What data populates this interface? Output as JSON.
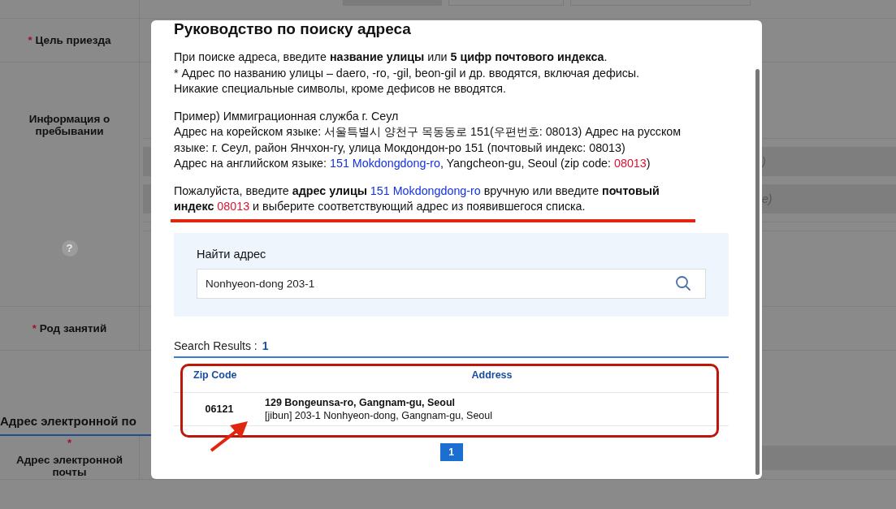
{
  "background_form": {
    "rows": [
      {
        "label": "Цель приезда",
        "mark": "*",
        "kind": "short"
      },
      {
        "label": "Информация о пребывании",
        "help": "?",
        "kind": "tall",
        "field_fragments": [
          ")",
          "e)"
        ]
      },
      {
        "label": "Род занятий",
        "mark": "*",
        "kind": "short"
      }
    ],
    "section_title": "Адрес электронной по",
    "email_row": {
      "label": "Адрес электронной почты",
      "mark": "*"
    }
  },
  "modal": {
    "title": "Руководство по поиску адреса",
    "blocks": [
      [
        [
          {
            "t": "При поиске адреса, введите ",
            "kind": "plain"
          },
          {
            "t": "название улицы",
            "kind": "bold"
          },
          {
            "t": " или ",
            "kind": "plain"
          },
          {
            "t": "5 цифр почтового индекса",
            "kind": "bold"
          },
          {
            "t": ".",
            "kind": "plain"
          }
        ],
        [
          {
            "t": "* Адрес по названию улицы – daero, -ro, -gil, beon-gil и др. вводятся, включая дефисы.",
            "kind": "plain"
          }
        ],
        [
          {
            "t": "Никакие специальные символы, кроме дефисов не вводятся.",
            "kind": "plain"
          }
        ]
      ],
      [
        [
          {
            "t": "Пример) Иммиграционная служба г. Сеул",
            "kind": "plain"
          }
        ],
        [
          {
            "t": "Адрес на корейском языке: 서울특별시 양천구 목동동로 151(우편번호: 08013) Адрес на русском языке: г. Сеул, район Янчхон-гу, улица Мокдондон-ро 151 (почтовый индекс: 08013)",
            "kind": "plain"
          }
        ],
        [
          {
            "t": "Адрес на английском языке: ",
            "kind": "plain"
          },
          {
            "t": "151 Mokdongdong-ro",
            "kind": "link"
          },
          {
            "t": ", Yangcheon-gu, Seoul (zip code: ",
            "kind": "plain"
          },
          {
            "t": "08013",
            "kind": "zip"
          },
          {
            "t": ")",
            "kind": "plain"
          }
        ]
      ],
      [
        [
          {
            "t": "Пожалуйста, введите ",
            "kind": "plain"
          },
          {
            "t": "адрес улицы ",
            "kind": "bold"
          },
          {
            "t": "151 Mokdongdong-ro",
            "kind": "link"
          },
          {
            "t": " вручную или введите ",
            "kind": "plain"
          },
          {
            "t": "почтовый индекс ",
            "kind": "bold"
          },
          {
            "t": "08013",
            "kind": "zip"
          },
          {
            "t": " и выберите соответствующий адрес из появившегося списка.",
            "kind": "plain"
          }
        ]
      ]
    ],
    "search": {
      "label": "Найти адрес",
      "value": "Nonhyeon-dong 203-1"
    },
    "results": {
      "label": "Search Results :",
      "count": "1",
      "columns": [
        "Zip Code",
        "Address"
      ],
      "rows": [
        {
          "zip": "06121",
          "road": "129 Bongeunsa-ro, Gangnam-gu, Seoul",
          "jibun": "[jibun] 203-1 Nonhyeon-dong, Gangnam-gu, Seoul"
        }
      ]
    },
    "pagination": [
      {
        "label": "1",
        "selected": true
      }
    ]
  }
}
